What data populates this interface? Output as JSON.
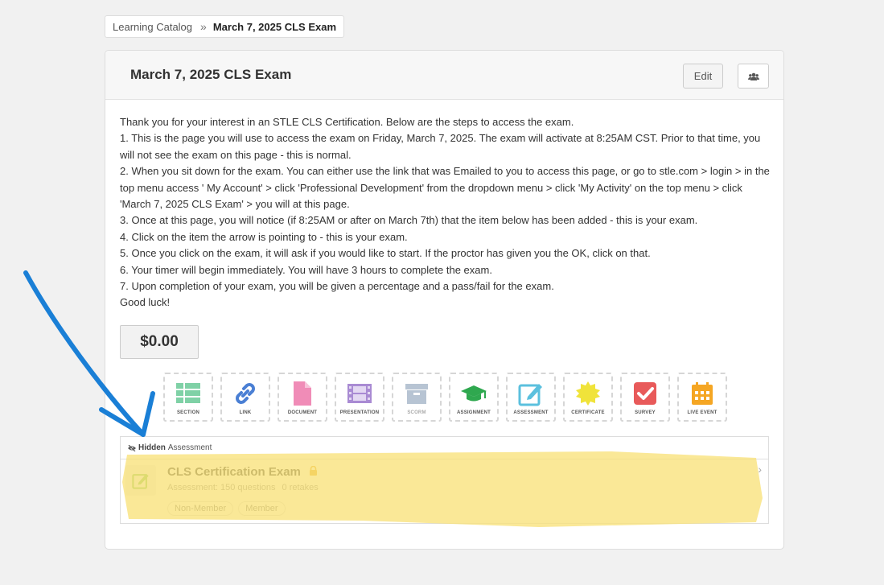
{
  "breadcrumb": {
    "root": "Learning Catalog",
    "separator": "»",
    "current": "March 7, 2025 CLS Exam"
  },
  "page": {
    "title": "March 7, 2025 CLS Exam",
    "edit_label": "Edit",
    "users_icon": "users-icon"
  },
  "instructions": [
    "Thank you for your interest in an STLE CLS Certification.   Below are the steps to access the exam.",
    "1.  This is the page you will use to access the exam on Friday, March 7, 2025.   The exam will activate at 8:25AM CST.   Prior to that time, you will not see the exam on this page - this is normal.",
    "2. When you sit down for the exam.  You can either use the link that was Emailed to you to access this page, or go to stle.com > login > in the top menu access ' My Account' > click 'Professional Development' from the dropdown menu > click 'My Activity' on the top menu > click 'March 7, 2025 CLS Exam' > you will at this page.",
    "3. Once at this page, you will notice (if 8:25AM or after on March 7th) that the item below has been added - this is your exam.",
    "4. Click on the item the arrow is pointing to - this is your exam.",
    "5. Once you click on the exam, it will ask if you would like to start.   If the proctor has given you the OK, click on that.",
    "6. Your timer will begin immediately.  You will have 3 hours to complete the exam.",
    "7. Upon completion of your exam, you will be given a percentage and a pass/fail for the exam.",
    "Good luck!"
  ],
  "price": "$0.00",
  "tiles": [
    {
      "label": "SECTION",
      "icon": "section-icon",
      "color": "#7fd1a6"
    },
    {
      "label": "LINK",
      "icon": "link-icon",
      "color": "#4a7fd4"
    },
    {
      "label": "DOCUMENT",
      "icon": "document-icon",
      "color": "#f08cb7"
    },
    {
      "label": "PRESENTATION",
      "icon": "film-icon",
      "color": "#a98bd3"
    },
    {
      "label": "SCORM",
      "icon": "box-icon",
      "color": "#b7c4d3"
    },
    {
      "label": "ASSIGNMENT",
      "icon": "graduation-cap-icon",
      "color": "#2fa84f"
    },
    {
      "label": "ASSESSMENT",
      "icon": "edit-icon",
      "color": "#5bc0de"
    },
    {
      "label": "CERTIFICATE",
      "icon": "certificate-icon",
      "color": "#f0e33a"
    },
    {
      "label": "SURVEY",
      "icon": "checkbox-icon",
      "color": "#e85a5a"
    },
    {
      "label": "LIVE EVENT",
      "icon": "calendar-icon",
      "color": "#f5a623"
    }
  ],
  "item": {
    "visibility": "Hidden",
    "type": "Assessment",
    "title": "CLS Certification Exam",
    "subtitle": "Assessment: 150 questions",
    "retakes": "0 retakes",
    "tags": [
      "Non-Member",
      "Member"
    ]
  },
  "colors": {
    "highlight": "#f9e27a",
    "arrow": "#1a7fd6"
  }
}
